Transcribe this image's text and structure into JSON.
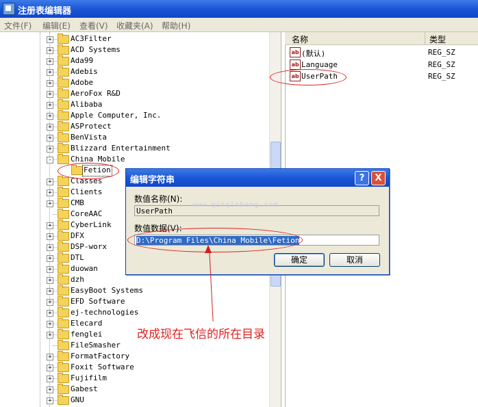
{
  "window": {
    "title": "注册表编辑器"
  },
  "menu": [
    "文件(F)",
    "编辑(E)",
    "查看(V)",
    "收藏夹(A)",
    "帮助(H)"
  ],
  "tree": {
    "items": [
      {
        "label": "AC3Filter",
        "expander": "+"
      },
      {
        "label": "ACD Systems",
        "expander": "+"
      },
      {
        "label": "Ada99",
        "expander": "+"
      },
      {
        "label": "Adebis",
        "expander": "+"
      },
      {
        "label": "Adobe",
        "expander": "+"
      },
      {
        "label": "AeroFox R&D",
        "expander": "+"
      },
      {
        "label": "Alibaba",
        "expander": "+"
      },
      {
        "label": "Apple Computer, Inc.",
        "expander": "+"
      },
      {
        "label": "ASProtect",
        "expander": "+"
      },
      {
        "label": "BenVista",
        "expander": "+"
      },
      {
        "label": "Blizzard Entertainment",
        "expander": "+"
      },
      {
        "label": "China Mobile",
        "expander": "-"
      },
      {
        "label": "Fetion",
        "expander": "",
        "child": true
      },
      {
        "label": "Classes",
        "expander": "+"
      },
      {
        "label": "Clients",
        "expander": "+"
      },
      {
        "label": "CMB",
        "expander": "+"
      },
      {
        "label": "CoreAAC",
        "expander": ""
      },
      {
        "label": "CyberLink",
        "expander": "+"
      },
      {
        "label": "DFX",
        "expander": "+"
      },
      {
        "label": "DSP-worx",
        "expander": "+"
      },
      {
        "label": "DTL",
        "expander": "+"
      },
      {
        "label": "duowan",
        "expander": "+"
      },
      {
        "label": "dzh",
        "expander": "+"
      },
      {
        "label": "EasyBoot Systems",
        "expander": "+"
      },
      {
        "label": "EFD Software",
        "expander": "+"
      },
      {
        "label": "ej-technologies",
        "expander": "+"
      },
      {
        "label": "Elecard",
        "expander": "+"
      },
      {
        "label": "fenglei",
        "expander": "+"
      },
      {
        "label": "FileSmasher",
        "expander": ""
      },
      {
        "label": "FormatFactory",
        "expander": "+"
      },
      {
        "label": "Foxit Software",
        "expander": "+"
      },
      {
        "label": "Fujifilm",
        "expander": "+"
      },
      {
        "label": "Gabest",
        "expander": "+"
      },
      {
        "label": "GNU",
        "expander": "+"
      }
    ]
  },
  "values": {
    "columns": {
      "name": "名称",
      "type": "类型"
    },
    "rows": [
      {
        "icon": "ab",
        "name": "(默认)",
        "type": "REG_SZ"
      },
      {
        "icon": "ab",
        "name": "Language",
        "type": "REG_SZ"
      },
      {
        "icon": "ab",
        "name": "UserPath",
        "type": "REG_SZ"
      }
    ]
  },
  "dialog": {
    "title": "编辑字符串",
    "help_glyph": "?",
    "close_glyph": "X",
    "name_label": "数值名称(N):",
    "name_value": "UserPath",
    "data_label": "数值数据(V):",
    "data_value": "D:\\Program Files\\China Mobile\\Fetion",
    "ok": "确定",
    "cancel": "取消"
  },
  "watermark": "www.qinqinbang.com",
  "annotation": "改成现在飞信的所在目录"
}
